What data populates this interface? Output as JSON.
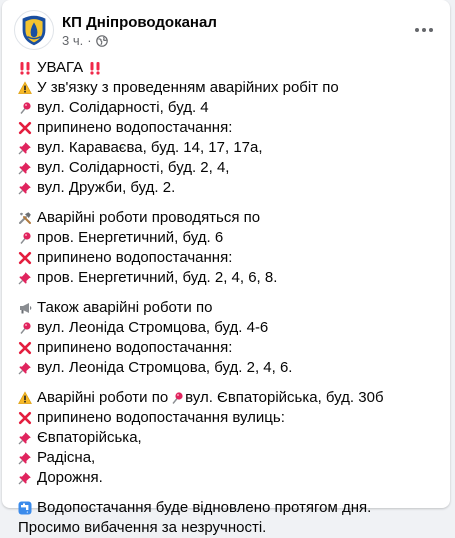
{
  "header": {
    "page_name": "КП Дніпроводоканал",
    "time": "3 ч.",
    "separator": "·",
    "privacy_icon": "globe-icon",
    "more_icon": "more-options-icon"
  },
  "post": {
    "lines": [
      {
        "icon": "double-exclamation-icon",
        "icon2": "double-exclamation-icon",
        "text": "УВАГА"
      },
      {
        "icon": "warning-icon",
        "text": "У зв'язку з проведенням аварійних робіт по"
      },
      {
        "icon": "pin-icon",
        "text": "вул. Солідарності, буд. 4"
      },
      {
        "icon": "cross-mark-icon",
        "text": "припинено водопостачання:"
      },
      {
        "icon": "pushpin-icon",
        "text": "вул. Караваєва, буд. 14, 17, 17а,"
      },
      {
        "icon": "pushpin-icon",
        "text": "вул. Солідарності, буд. 2, 4,"
      },
      {
        "icon": "pushpin-icon",
        "text": "вул. Дружби, буд. 2."
      },
      {
        "icon": "tools-icon",
        "text": "Аварійні роботи проводяться по"
      },
      {
        "icon": "pin-icon",
        "text": "пров. Енергетичний, буд. 6"
      },
      {
        "icon": "cross-mark-icon",
        "text": "припинено водопостачання:"
      },
      {
        "icon": "pushpin-icon",
        "text": "пров. Енергетичний, буд. 2, 4, 6, 8."
      },
      {
        "icon": "megaphone-icon",
        "text": "Також аварійні роботи по"
      },
      {
        "icon": "pin-icon",
        "text": "вул. Леоніда Стромцова, буд. 4-6"
      },
      {
        "icon": "cross-mark-icon",
        "text": "припинено водопостачання:"
      },
      {
        "icon": "pushpin-icon",
        "text": "вул. Леоніда Стромцова, буд. 2, 4, 6."
      },
      {
        "icon": "warning-icon",
        "text": "Аварійні роботи по",
        "icon2": "pin-icon",
        "text2": "вул. Євпаторійська, буд. 30б"
      },
      {
        "icon": "cross-mark-icon",
        "text": "припинено водопостачання вулиць:"
      },
      {
        "icon": "pushpin-icon",
        "text": "Євпаторійська,"
      },
      {
        "icon": "pushpin-icon",
        "text": "Радісна,"
      },
      {
        "icon": "pushpin-icon",
        "text": "Дорожня."
      },
      {
        "icon": "water-tap-icon",
        "text": "Водопостачання буде відновлено протягом дня."
      },
      {
        "text": "Просимо вибачення за незручності."
      }
    ]
  },
  "colors": {
    "text": "#050505",
    "secondary": "#65676b",
    "card": "#ffffff",
    "background": "#f0f2f5",
    "exclamation": "#f02849",
    "warning": "#f7b928",
    "cross": "#e41e3f",
    "pin": "#e0245e"
  }
}
